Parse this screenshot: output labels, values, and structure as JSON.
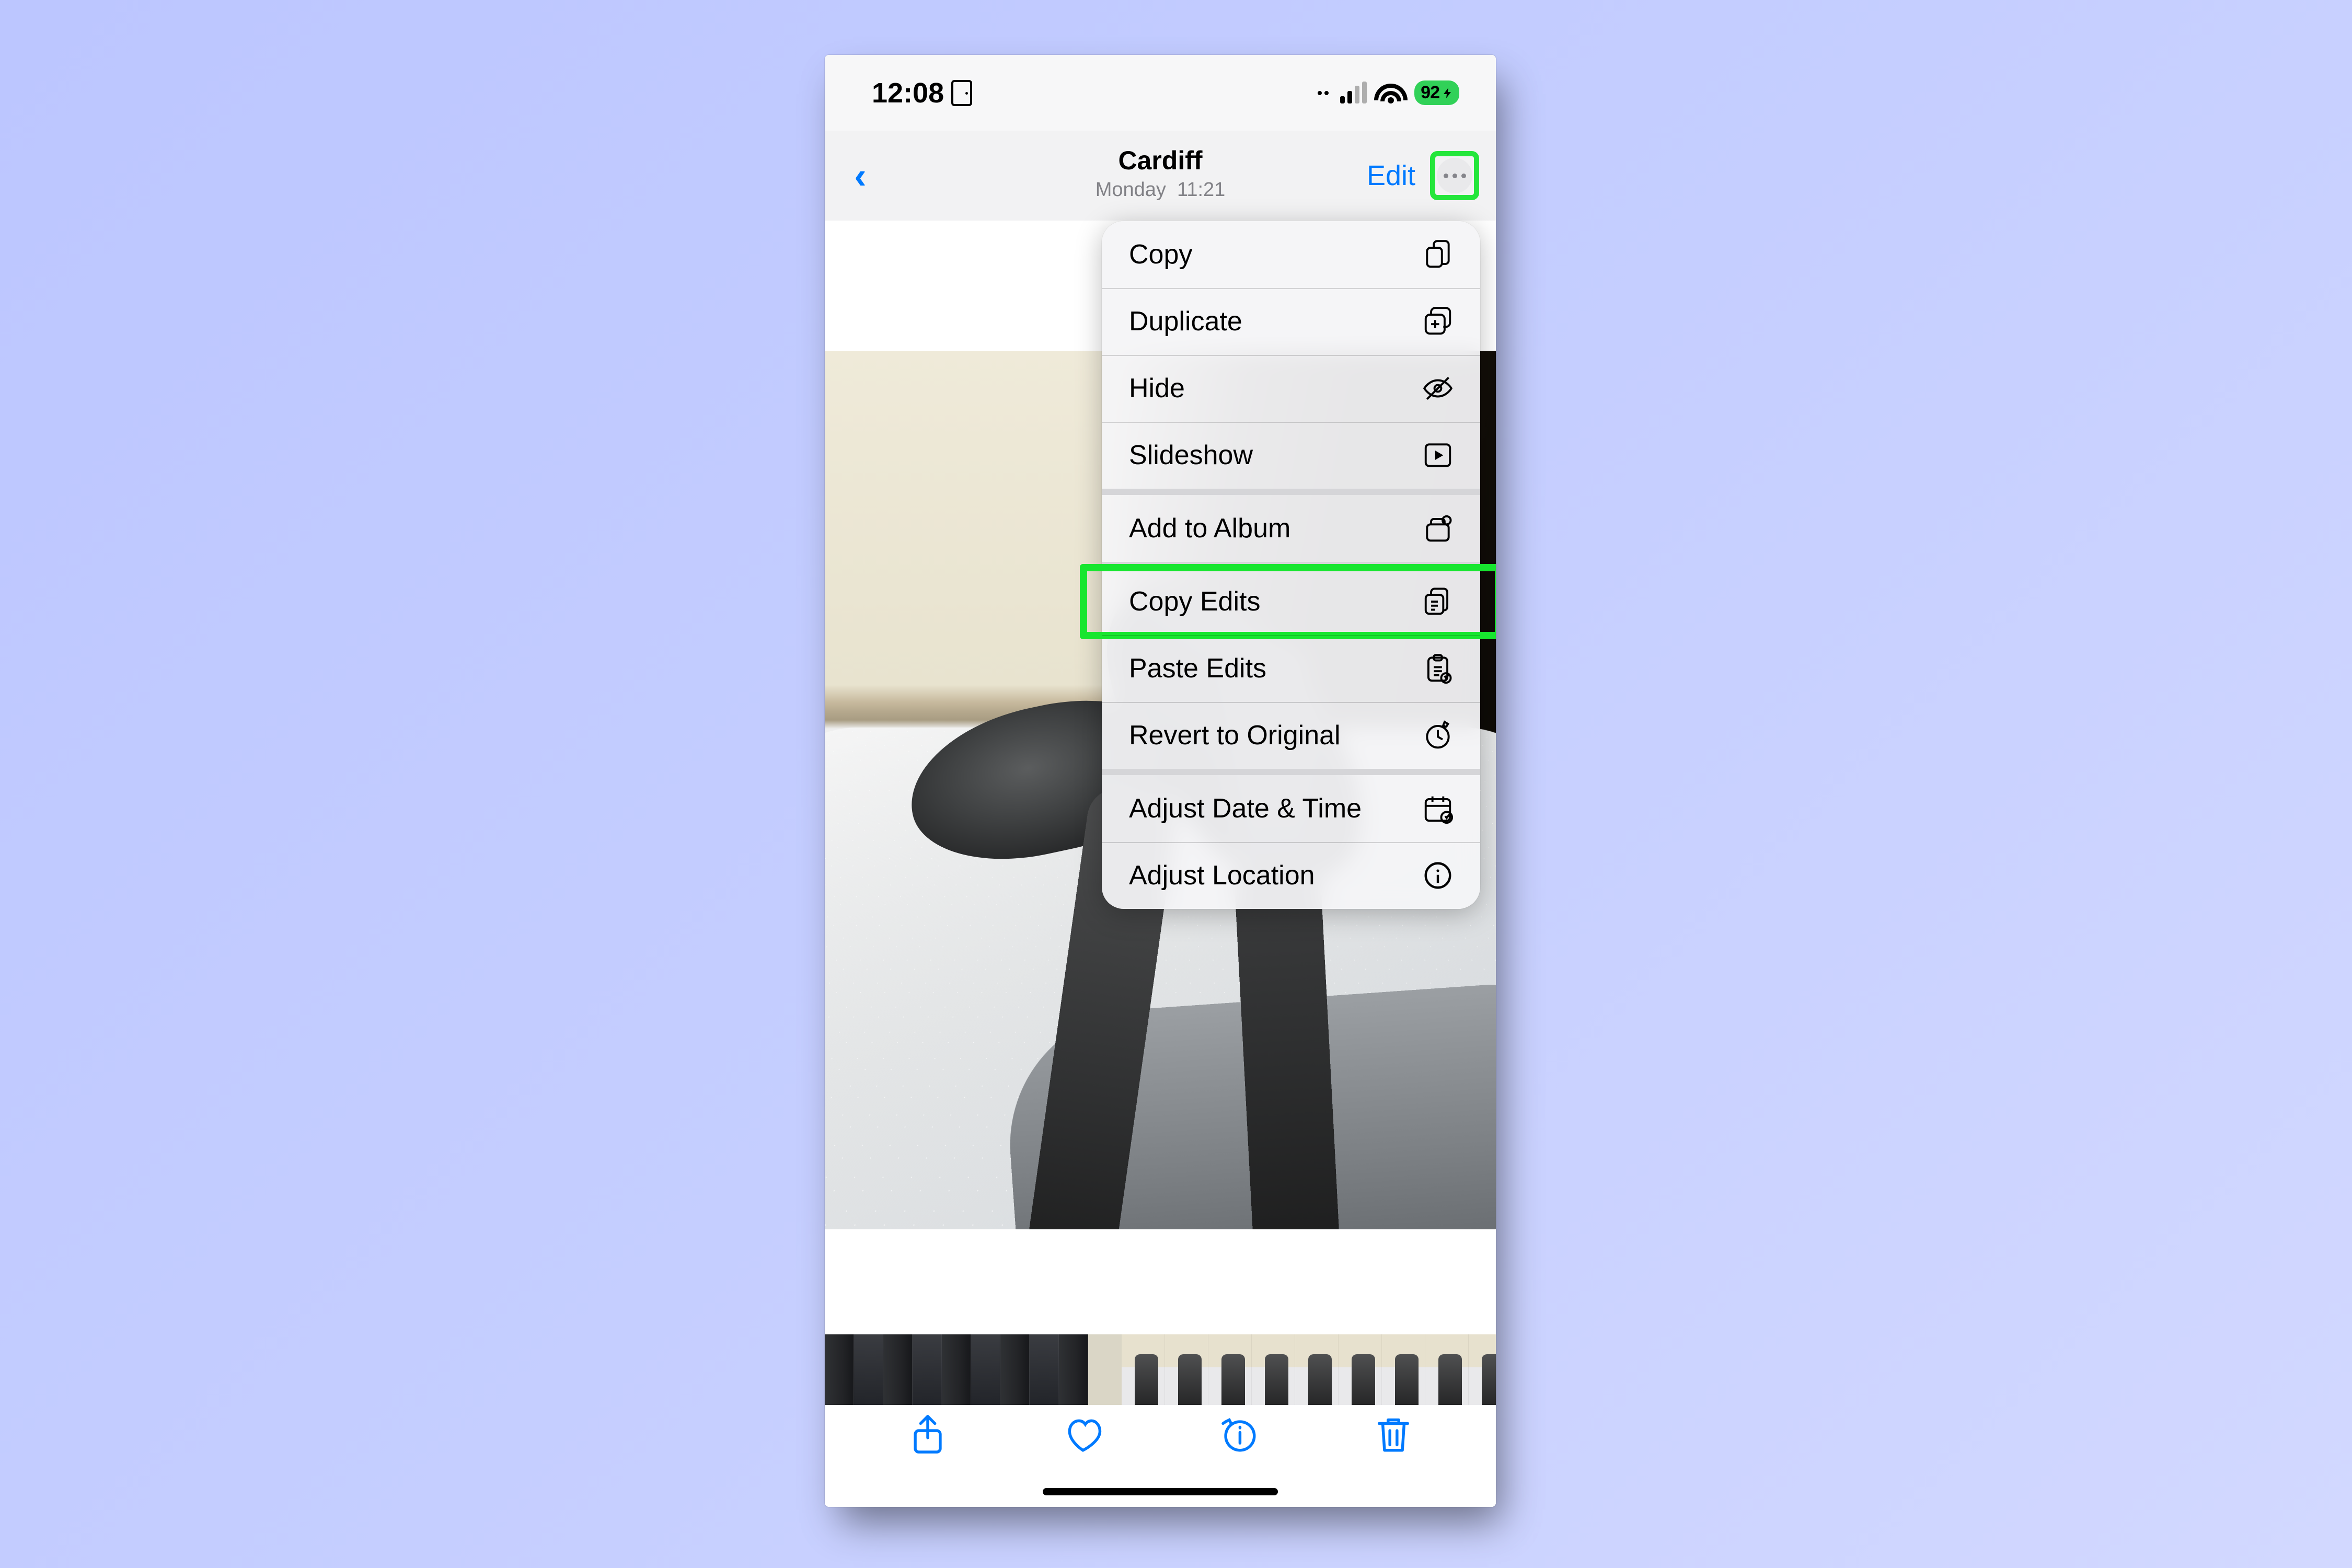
{
  "status": {
    "time": "12:08",
    "battery": "92"
  },
  "header": {
    "title": "Cardiff",
    "subtitle_day": "Monday",
    "subtitle_time": "11:21",
    "edit_label": "Edit"
  },
  "menu": {
    "groups": [
      [
        {
          "key": "copy",
          "label": "Copy",
          "icon": "copy"
        },
        {
          "key": "duplicate",
          "label": "Duplicate",
          "icon": "duplicate"
        },
        {
          "key": "hide",
          "label": "Hide",
          "icon": "hide"
        },
        {
          "key": "slideshow",
          "label": "Slideshow",
          "icon": "slideshow"
        }
      ],
      [
        {
          "key": "add-album",
          "label": "Add to Album",
          "icon": "album"
        }
      ],
      [
        {
          "key": "copy-edits",
          "label": "Copy Edits",
          "icon": "copy-edits",
          "highlight": true
        },
        {
          "key": "paste-edits",
          "label": "Paste Edits",
          "icon": "paste-edits"
        },
        {
          "key": "revert",
          "label": "Revert to Original",
          "icon": "revert"
        }
      ],
      [
        {
          "key": "adjust-date",
          "label": "Adjust Date & Time",
          "icon": "date"
        },
        {
          "key": "adjust-location",
          "label": "Adjust Location",
          "icon": "location"
        }
      ]
    ]
  },
  "highlight_targets": {
    "more_button": true,
    "copy_edits_row": true
  }
}
